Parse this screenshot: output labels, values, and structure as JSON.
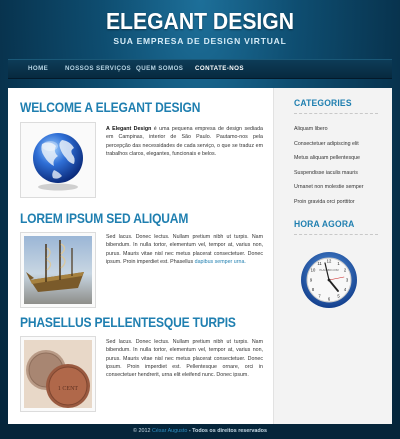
{
  "header": {
    "logo": "ELEGANT DESIGN",
    "tagline": "SUA EMPRESA DE DESIGN VIRTUAL"
  },
  "nav": {
    "items": [
      "HOME",
      "NOSSOS SERVIÇOS",
      "QUEM SOMOS",
      "CONTATE-NOS"
    ],
    "active": "CONTATE-NOS"
  },
  "main": {
    "sections": [
      {
        "title": "WELCOME A ELEGANT DESIGN",
        "image": "globe-image",
        "text_bold": "A Elegant Design",
        "text": " é uma pequena empresa de design sediada em Campinas, interior de São Paulo. Pautamo-nos pela percepção das necessidades de cada serviço, o que se traduz em trabalhos claros, elegantes, funcionais e belos.",
        "link": ""
      },
      {
        "title": "LOREM IPSUM SED ALIQUAM",
        "image": "ship-image",
        "text": "Sed lacus. Donec lectus. Nullam pretium nibh ut turpis. Nam bibendum. In nulla tortor, elementum vel, tempor at, varius non, purus. Mauris vitae nisl nec metus placerat consectetuer. Donec ipsum. Proin imperdiet est. Phasellus ",
        "link": "dapibus semper urna."
      },
      {
        "title": "PHASELLUS PELLENTESQUE TURPIS",
        "image": "coins-image",
        "text": "Sed lacus. Donec lectus. Nullam pretium nibh ut turpis. Nam bibendum. In nulla tortor, elementum vel, tempor at, varius non, purus. Mauris vitae nisl nec metus placerat consectetuer. Donec ipsum. Proin imperdiet est. Pellentesque ornare, orci in consectetuer hendrerit, urna elit eleifend nunc. Donec ipsum.",
        "link": ""
      }
    ]
  },
  "sidebar": {
    "categories_title": "CATEGORIES",
    "categories": [
      "Aliquam libero",
      "Consectetuer adipiscing elit",
      "Metus aliquam pellentesque",
      "Suspendisse iaculis mauris",
      "Urnanet non molestie semper",
      "Proin gravida orci porttitor"
    ],
    "clock_title": "HORA AGORA",
    "clock_brand": "PLACEBO.COM"
  },
  "footer": {
    "year": "© 2012",
    "name": "César Augusto",
    "rights": " - Todos os direitos reservados"
  },
  "colors": {
    "accent": "#1f7fb0",
    "background": "#0e4d70",
    "nav": "#0b3550",
    "footer": "#05253a"
  }
}
